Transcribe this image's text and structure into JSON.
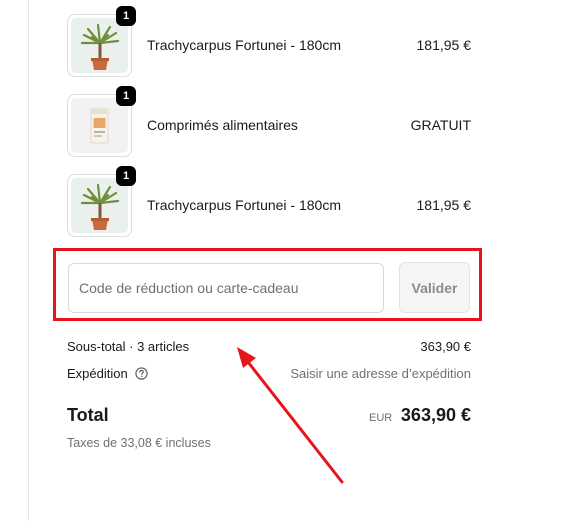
{
  "cart": {
    "items": [
      {
        "name": "Trachycarpus Fortunei - 180cm",
        "price": "181,95 €",
        "quantity": "1",
        "image": "palm-tree-pot"
      },
      {
        "name": "Comprimés alimentaires",
        "price": "GRATUIT",
        "quantity": "1",
        "image": "fertilizer-sachet"
      },
      {
        "name": "Trachycarpus Fortunei - 180cm",
        "price": "181,95 €",
        "quantity": "1",
        "image": "palm-tree-pot"
      }
    ]
  },
  "discount": {
    "placeholder": "Code de réduction ou carte-cadeau",
    "value": "",
    "button_label": "Valider"
  },
  "summary": {
    "subtotal_label": "Sous-total · 3 articles",
    "subtotal_value": "363,90 €",
    "shipping_label": "Expédition",
    "shipping_value": "Saisir une adresse d’expédition",
    "total_label": "Total",
    "currency": "EUR",
    "total_value": "363,90 €",
    "taxes_note": "Taxes de 33,08 € incluses"
  },
  "annotation": {
    "color": "#e8141c"
  }
}
